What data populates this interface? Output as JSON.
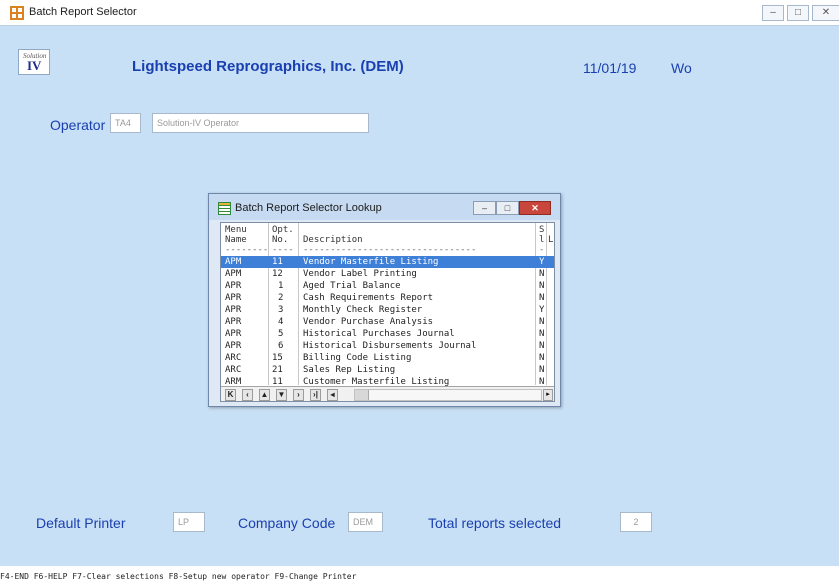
{
  "window": {
    "title": "Batch Report Selector",
    "min_label": "–",
    "max_label": "□",
    "close_label": "✕"
  },
  "header": {
    "logo_small": "Solution",
    "logo_big": "IV",
    "company": "Lightspeed Reprographics, Inc. (DEM)",
    "date": "11/01/19",
    "day": "Wo"
  },
  "operator": {
    "label": "Operator",
    "code": "TA4",
    "name": "Solution-IV Operator"
  },
  "lookup": {
    "title": "Batch Report Selector Lookup",
    "min_label": "–",
    "max_label": "□",
    "close_label": "✕",
    "headers": {
      "menu_line1": "Menu",
      "menu_line2": "Name",
      "opt_line1": "Opt.",
      "opt_line2": "No.",
      "desc": "Description",
      "sel_line1": "S",
      "sel_line2": "l",
      "extra": "L"
    },
    "dashes": {
      "menu": "--------",
      "opt": "----",
      "desc": "--------------------------------",
      "sel": "-"
    },
    "rows": [
      {
        "menu": "APM",
        "opt": "11",
        "desc": "Vendor Masterfile Listing",
        "sel": "Y",
        "selected": true
      },
      {
        "menu": "APM",
        "opt": "12",
        "desc": "Vendor Label Printing",
        "sel": "N"
      },
      {
        "menu": "APR",
        "opt": "1",
        "desc": "Aged Trial Balance",
        "sel": "N"
      },
      {
        "menu": "APR",
        "opt": "2",
        "desc": "Cash Requirements Report",
        "sel": "N"
      },
      {
        "menu": "APR",
        "opt": "3",
        "desc": "Monthly Check Register",
        "sel": "Y"
      },
      {
        "menu": "APR",
        "opt": "4",
        "desc": "Vendor Purchase Analysis",
        "sel": "N"
      },
      {
        "menu": "APR",
        "opt": "5",
        "desc": "Historical Purchases Journal",
        "sel": "N"
      },
      {
        "menu": "APR",
        "opt": "6",
        "desc": "Historical Disbursements Journal",
        "sel": "N"
      },
      {
        "menu": "ARC",
        "opt": "15",
        "desc": "Billing Code Listing",
        "sel": "N"
      },
      {
        "menu": "ARC",
        "opt": "21",
        "desc": "Sales Rep Listing",
        "sel": "N"
      },
      {
        "menu": "ARM",
        "opt": "11",
        "desc": "Customer Masterfile Listing",
        "sel": "N"
      }
    ],
    "nav": [
      "K",
      "‹",
      "▲",
      "▼",
      "›",
      "›|",
      "◂"
    ],
    "scroll_right": "▸"
  },
  "footer_fields": {
    "printer_label": "Default Printer",
    "printer_value": "LP",
    "company_label": "Company Code",
    "company_value": "DEM",
    "total_label": "Total reports selected",
    "total_value": "2"
  },
  "status_bar": "F4-END  F6-HELP  F7-Clear selections  F8-Setup new operator  F9-Change Printer",
  "colors": {
    "background": "#c8e0f5",
    "label_blue": "#1a3fb0",
    "selection": "#3e7fd8",
    "close_red": "#c9463d"
  }
}
